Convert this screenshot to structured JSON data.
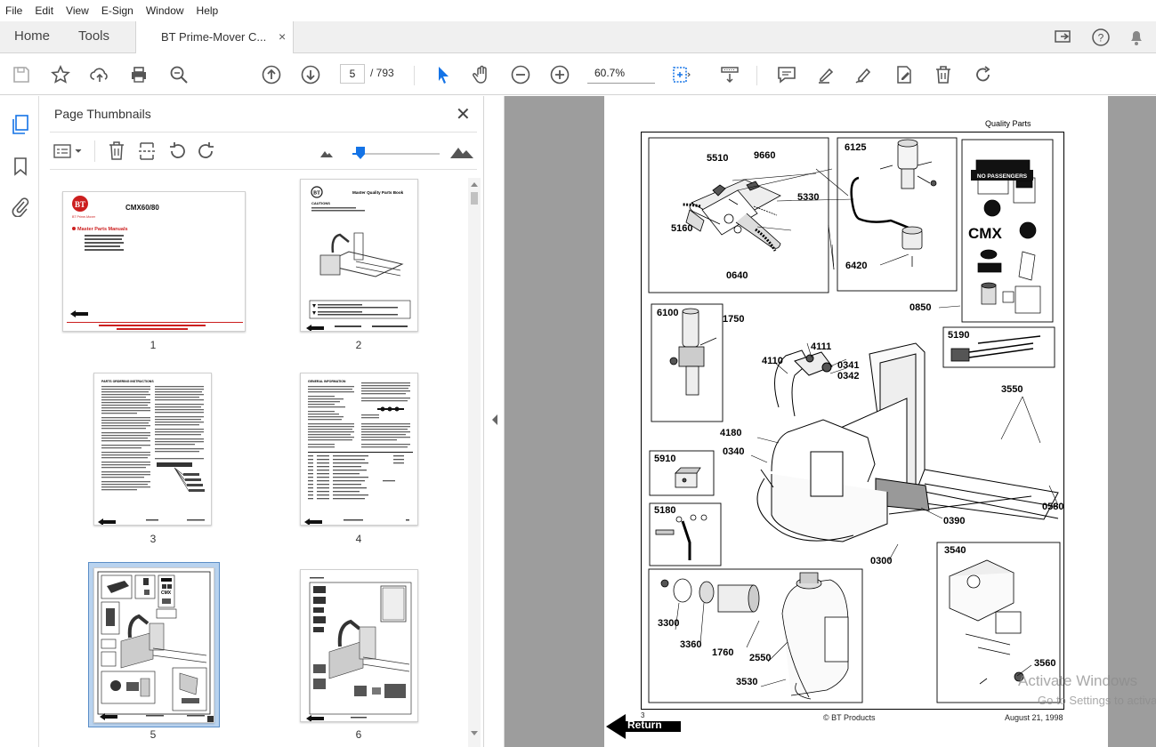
{
  "menu": [
    "File",
    "Edit",
    "View",
    "E-Sign",
    "Window",
    "Help"
  ],
  "tabs": {
    "home": "Home",
    "tools": "Tools",
    "document": "BT Prime-Mover C...",
    "close": "×"
  },
  "toolbar": {
    "page_current": "5",
    "page_total": "/  793",
    "zoom": "60.7%"
  },
  "icons": [
    "save-icon",
    "star-icon",
    "upload-icon",
    "print-icon",
    "find-icon",
    "prev-page-icon",
    "next-page-icon",
    "select-icon",
    "hand-icon",
    "zoom-out-icon",
    "zoom-in-icon",
    "fit-icon",
    "scroll-mode-icon",
    "comment-icon",
    "highlight-icon",
    "sign-icon",
    "edit-icon",
    "delete-icon",
    "undo-icon",
    "share-icon",
    "help-icon",
    "bell-icon"
  ],
  "panel": {
    "title": "Page Thumbnails",
    "close": "✕"
  },
  "thumbnails": [
    {
      "num": "1",
      "title": "CMX60/80",
      "subtitle": "Master Parts Manuals",
      "logo_caption": "BT Prime-Mover"
    },
    {
      "num": "2",
      "title": "Master Quality Parts Book",
      "subtitle": "CAUTIONS"
    },
    {
      "num": "3",
      "title": "PARTS ORDERING INSTRUCTIONS"
    },
    {
      "num": "4",
      "title": "GENERAL INFORMATION"
    },
    {
      "num": "5",
      "title": ""
    },
    {
      "num": "6",
      "title": ""
    }
  ],
  "document": {
    "header": "Quality Parts",
    "callouts": [
      "5510",
      "9660",
      "5330",
      "5160",
      "0640",
      "6125",
      "6420",
      "0850",
      "6100",
      "1750",
      "4111",
      "4110",
      "0341",
      "0342",
      "5190",
      "3550",
      "4180",
      "0340",
      "5910",
      "5180",
      "0390",
      "0580",
      "0300",
      "3540",
      "3300",
      "3360",
      "1760",
      "2550",
      "3530",
      "3560"
    ],
    "footer_left": "© BT Products",
    "footer_right": "August 21, 1998",
    "return_label": "Return",
    "page_number": "3",
    "decal_no_passengers": "NO PASSENGERS",
    "decal_cmx": "CMX"
  },
  "watermark": {
    "line1": "Activate Windows",
    "line2": "Go to Settings to activa"
  },
  "colors": {
    "accent_red": "#cc1f1f",
    "toolbar_bg": "#f0f0f0",
    "doc_bg": "#9d9d9d",
    "select_blue": "#1473e6"
  }
}
